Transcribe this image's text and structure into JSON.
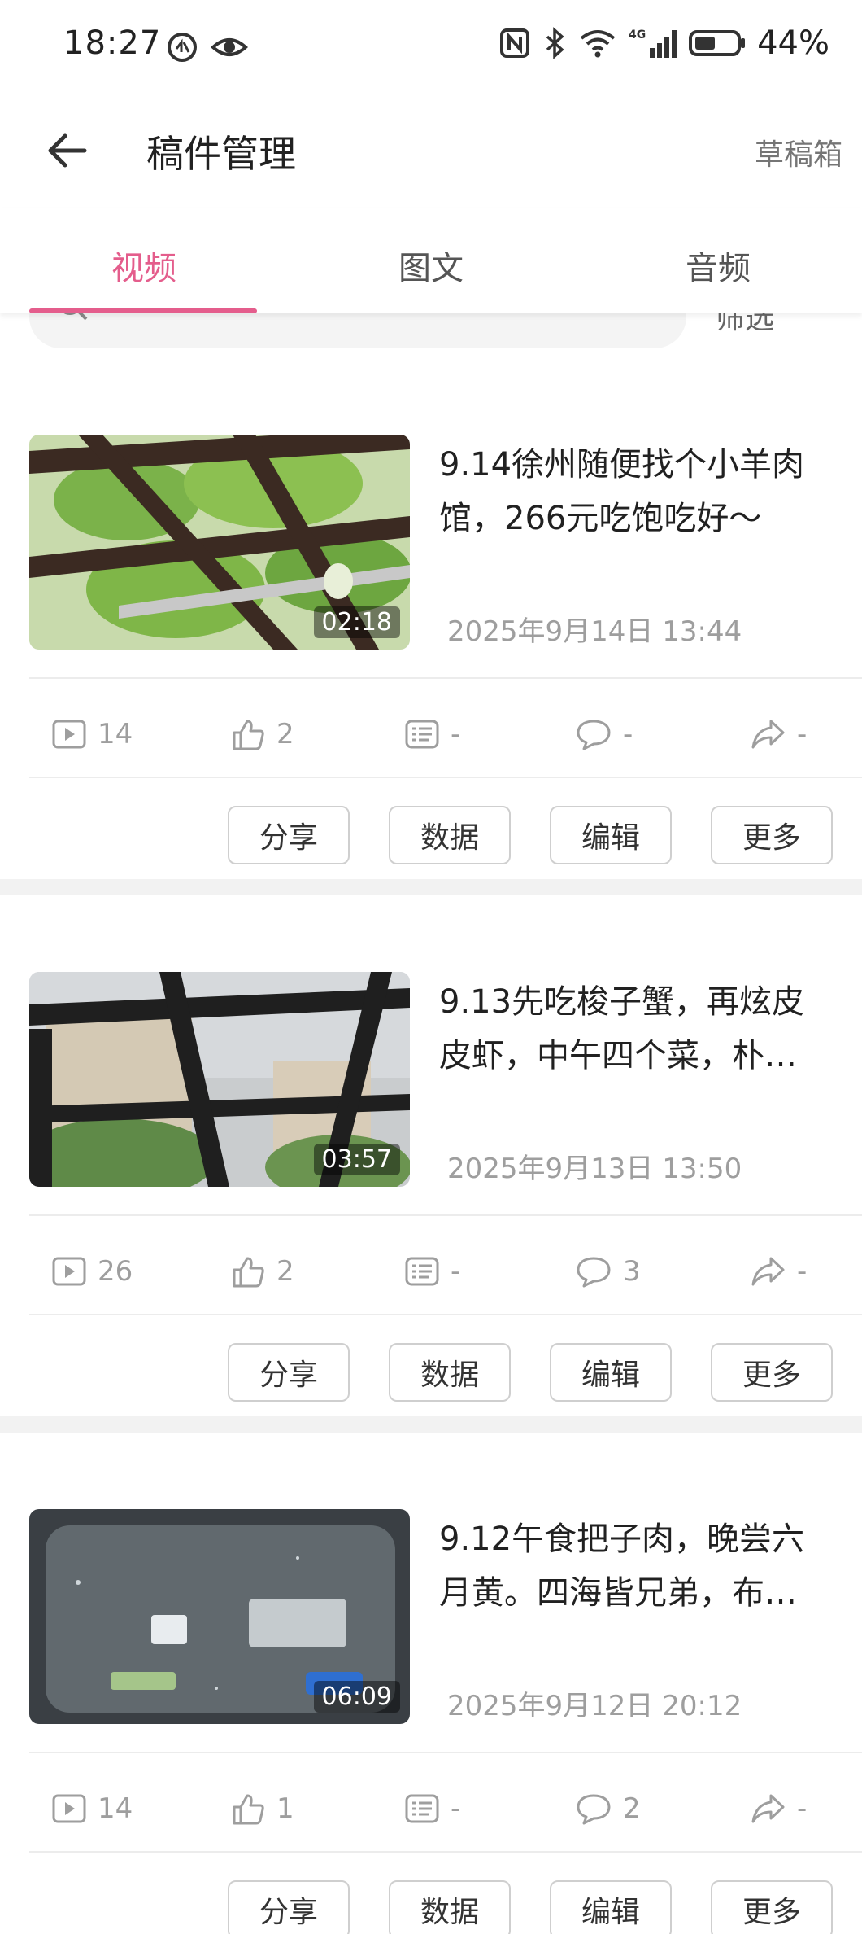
{
  "status_bar": {
    "time": "18:27",
    "battery": "44%",
    "network": "4G"
  },
  "header": {
    "title": "稿件管理",
    "drafts": "草稿箱"
  },
  "tabs": [
    {
      "label": "视频",
      "active": true
    },
    {
      "label": "图文",
      "active": false
    },
    {
      "label": "音频",
      "active": false
    }
  ],
  "filter_peek": "筛选",
  "videos": [
    {
      "title": "9.14徐州随便找个小羊肉馆，266元吃饱吃好～",
      "date": "2025年9月14日 13:44",
      "duration": "02:18",
      "stats": {
        "plays": "14",
        "likes": "2",
        "danmaku": "-",
        "comments": "-",
        "shares": "-"
      }
    },
    {
      "title": "9.13先吃梭子蟹，再炫皮皮虾，中午四个菜，朴…",
      "date": "2025年9月13日 13:50",
      "duration": "03:57",
      "stats": {
        "plays": "26",
        "likes": "2",
        "danmaku": "-",
        "comments": "3",
        "shares": "-"
      }
    },
    {
      "title": "9.12午食把子肉，晚尝六月黄。四海皆兄弟，布…",
      "date": "2025年9月12日 20:12",
      "duration": "06:09",
      "stats": {
        "plays": "14",
        "likes": "1",
        "danmaku": "-",
        "comments": "2",
        "shares": "-"
      }
    }
  ],
  "actions": {
    "share": "分享",
    "data": "数据",
    "edit": "编辑",
    "more": "更多"
  },
  "colors": {
    "accent": "#e45d8c",
    "muted": "#9e9e9e",
    "divider": "#f2f2f2"
  }
}
